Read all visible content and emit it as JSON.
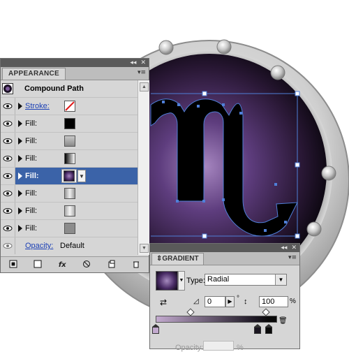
{
  "appearance_panel": {
    "tab_label": "APPEARANCE",
    "collapse_glyph": "◂◂",
    "close_glyph": "✕",
    "menu_glyph": "▾≡",
    "object_name": "Compound Path",
    "rows": [
      {
        "label": "Stroke:",
        "type": "stroke",
        "swatch": "none-stroke"
      },
      {
        "label": "Fill:",
        "type": "fill",
        "swatch": "black"
      },
      {
        "label": "Fill:",
        "type": "fill",
        "swatch": "gray-linear"
      },
      {
        "label": "Fill:",
        "type": "fill",
        "swatch": "black-white-linear"
      },
      {
        "label": "Fill:",
        "type": "fill",
        "swatch": "radial-purple",
        "selected": true
      },
      {
        "label": "Fill:",
        "type": "fill",
        "swatch": "gray-stripe"
      },
      {
        "label": "Fill:",
        "type": "fill",
        "swatch": "gray-stripe-2"
      },
      {
        "label": "Fill:",
        "type": "fill",
        "swatch": "gray-flat"
      }
    ],
    "opacity_label": "Opacity:",
    "opacity_value": "Default",
    "bottom_icons": [
      "new-stroke-icon",
      "new-fill-icon",
      "fx-icon",
      "clear-icon",
      "duplicate-icon",
      "trash-icon"
    ],
    "fx_label": "fx"
  },
  "gradient_panel": {
    "tab_label": "GRADIENT",
    "type_label": "Type:",
    "type_value": "Radial",
    "angle_value": "0",
    "aspect_value": "100",
    "percent_sign": "%",
    "degree_sign": "°",
    "opacity_label": "Opacity:",
    "opacity_percent": "%",
    "stops": [
      {
        "position": 0.0,
        "color": "#c3aacf"
      },
      {
        "position": 0.84,
        "color": "#1a1520"
      },
      {
        "position": 0.93,
        "color": "#0a0a0a"
      }
    ],
    "midpoints": [
      0.28,
      0.9
    ]
  },
  "colors": {
    "selection": "#3b63a8",
    "path_outline": "#4f7fd8",
    "porthole_inner": "#4a2c66"
  }
}
